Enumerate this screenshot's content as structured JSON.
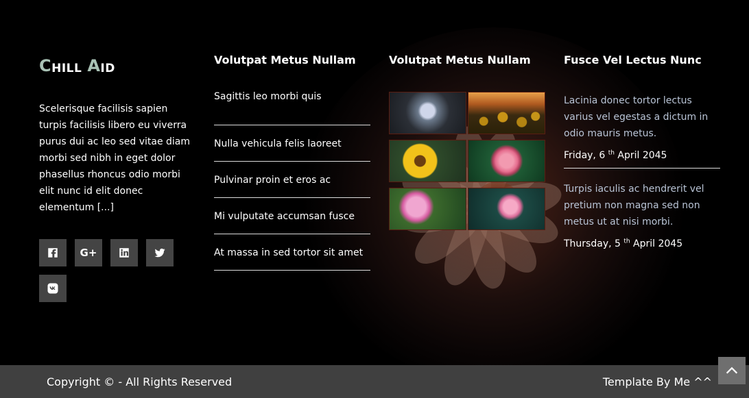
{
  "brand": {
    "logo_part1_initial": "C",
    "logo_part1_rest": "HILL",
    "logo_part2_initial": "A",
    "logo_part2_rest": "ID",
    "accent_color": "#a9c2b5"
  },
  "about": {
    "text": "Scelerisque facilisis sapien turpis facilisis libero eu viverra purus dui ac leo sed vitae diam morbi sed nibh in eget dolor phasellus rhoncus odio morbi elit nunc id elit donec elementum [...]"
  },
  "social": [
    {
      "icon": "facebook-icon"
    },
    {
      "icon": "google-plus-icon",
      "glyph": "G+"
    },
    {
      "icon": "linkedin-icon"
    },
    {
      "icon": "twitter-icon"
    },
    {
      "icon": "vk-icon"
    }
  ],
  "links_column": {
    "title": "Volutpat Metus Nullam",
    "items": [
      "Sagittis leo morbi quis",
      "Nulla vehicula felis laoreet",
      "Pulvinar proin et eros ac",
      "Mi vulputate accumsan fusce",
      "At massa in sed tortor sit amet"
    ]
  },
  "gallery_column": {
    "title": "Volutpat Metus Nullam",
    "images": [
      "lotus-image",
      "sunflower-field-image",
      "sunflower-image",
      "rose-image",
      "peony-image",
      "water-lily-image"
    ]
  },
  "posts_column": {
    "title": "Fusce Vel Lectus Nunc",
    "posts": [
      {
        "text": "Lacinia donec tortor lectus varius vel egestas a dictum in odio mauris metus.",
        "date_prefix": "Friday, 6",
        "date_sup": "th",
        "date_suffix": "April 2045"
      },
      {
        "text": "Turpis iaculis ac hendrerit vel pretium non magna sed non metus ut at nisi morbi.",
        "date_prefix": "Thursday, 5",
        "date_sup": "th",
        "date_suffix": "April 2045"
      }
    ]
  },
  "bottom": {
    "copyright": "Copyright © - All Rights Reserved",
    "credit": "Template By Me ^^"
  },
  "scroll_top": {
    "icon": "chevron-up-icon"
  }
}
